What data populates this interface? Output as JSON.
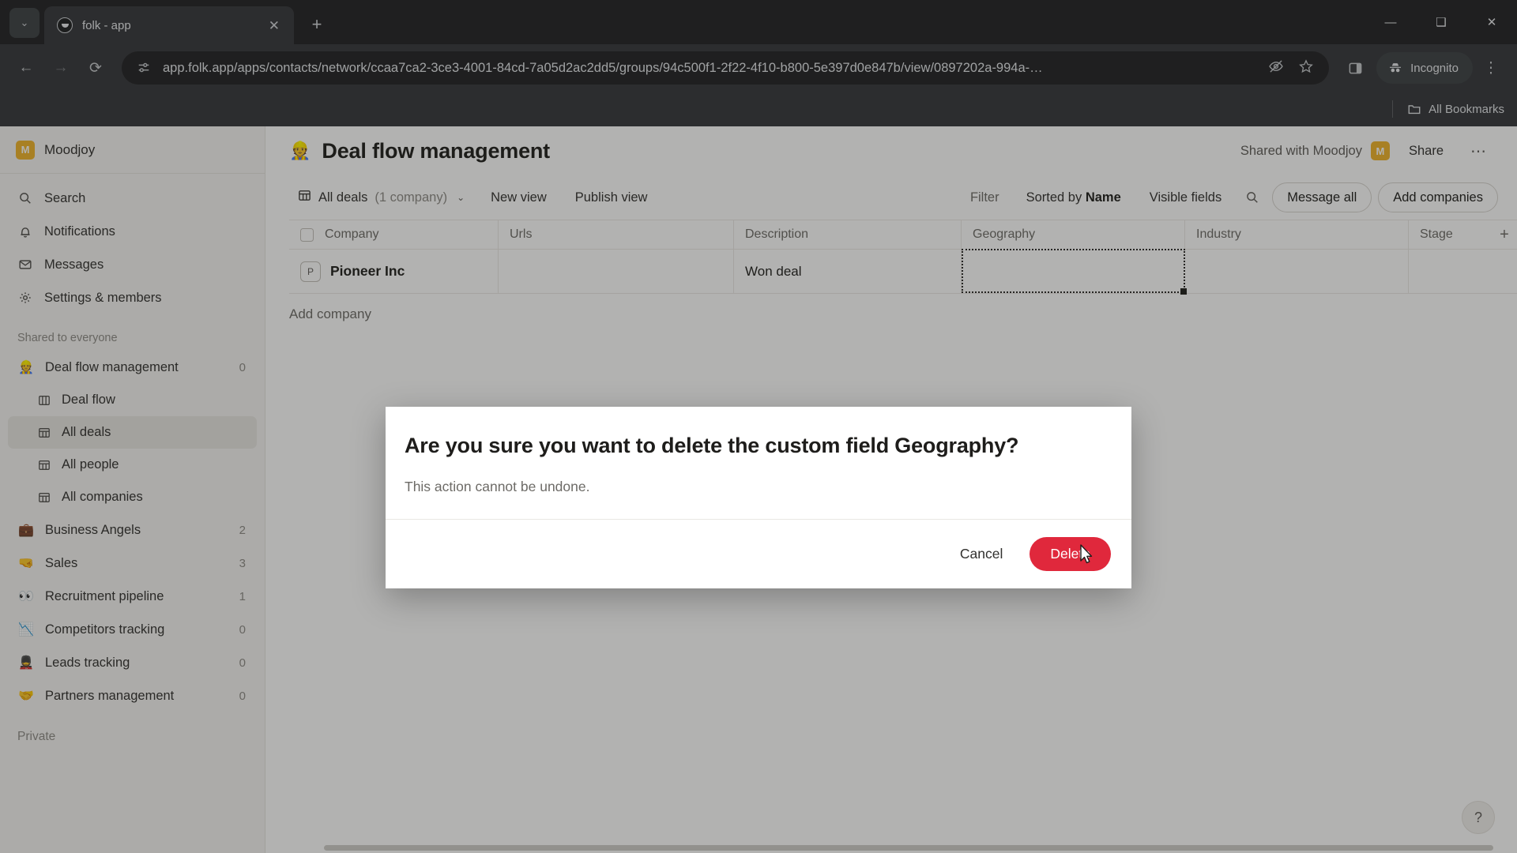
{
  "browser": {
    "tab": {
      "title": "folk - app",
      "favicon_name": "folk-favicon",
      "close_label": "✕"
    },
    "tab_list_chevron": "⌄",
    "new_tab_label": "+",
    "window_controls": {
      "minimize": "—",
      "maximize": "❑",
      "close": "✕"
    },
    "nav": {
      "back": "←",
      "forward": "→",
      "reload": "⟳"
    },
    "url": "app.folk.app/apps/contacts/network/ccaa7ca2-3ce3-4001-84cd-7a05d2ac2dd5/groups/94c500f1-2f22-4f10-b800-5e397d0e847b/view/0897202a-994a-…",
    "site_info_icon": "tune-icon",
    "hide_icon": "eye-off-icon",
    "bookmark_icon": "star-icon",
    "side_panel_icon": "side-panel-icon",
    "profile_label": "Incognito",
    "menu_icon": "⋮",
    "bookmarks_bar": {
      "all_bookmarks_label": "All Bookmarks",
      "folder_icon": "folder-icon"
    }
  },
  "sidebar": {
    "workspace": {
      "name": "Moodjoy",
      "initial": "M"
    },
    "nav_items": [
      {
        "label": "Search",
        "icon": "search-icon"
      },
      {
        "label": "Notifications",
        "icon": "bell-icon"
      },
      {
        "label": "Messages",
        "icon": "mail-icon"
      },
      {
        "label": "Settings & members",
        "icon": "gear-icon"
      }
    ],
    "shared_section_label": "Shared to everyone",
    "groups": [
      {
        "label": "Deal flow management",
        "count": "0",
        "emoji": "👷",
        "active": false
      },
      {
        "label": "Business Angels",
        "count": "2",
        "emoji": "💼"
      },
      {
        "label": "Sales",
        "count": "3",
        "emoji": "🤜"
      },
      {
        "label": "Recruitment pipeline",
        "count": "1",
        "emoji": "👀"
      },
      {
        "label": "Competitors tracking",
        "count": "0",
        "emoji": "📉"
      },
      {
        "label": "Leads tracking",
        "count": "0",
        "emoji": "💂"
      },
      {
        "label": "Partners management",
        "count": "0",
        "emoji": "🤝"
      }
    ],
    "subviews": [
      {
        "label": "Deal flow",
        "icon": "board-icon",
        "active": false
      },
      {
        "label": "All deals",
        "icon": "table-icon",
        "active": true
      },
      {
        "label": "All people",
        "icon": "table-icon",
        "active": false
      },
      {
        "label": "All companies",
        "icon": "table-icon",
        "active": false
      }
    ],
    "private_label": "Private"
  },
  "header": {
    "emoji": "👷",
    "title": "Deal flow management",
    "shared_with": "Shared with Moodjoy",
    "shared_avatar_initial": "M",
    "share_label": "Share",
    "more_label": "⋯"
  },
  "viewbar": {
    "view_icon": "table-icon",
    "view_name": "All deals",
    "view_count": "(1 company)",
    "chevron": "⌄",
    "new_view_label": "New view",
    "publish_view_label": "Publish view",
    "filter_label": "Filter",
    "sorted_by_prefix": "Sorted by ",
    "sorted_by_field": "Name",
    "visible_fields_label": "Visible fields",
    "search_icon": "search-icon",
    "message_all_label": "Message all",
    "add_companies_label": "Add companies"
  },
  "table": {
    "columns": [
      "Company",
      "Urls",
      "Description",
      "Geography",
      "Industry",
      "Stage"
    ],
    "add_column_label": "+",
    "rows": [
      {
        "badge": "P",
        "Company": "Pioneer Inc",
        "Urls": "",
        "Description": "Won deal",
        "Geography": "",
        "Industry": "",
        "Stage": ""
      }
    ],
    "selected_cell": "Geography",
    "add_company_label": "Add company"
  },
  "modal": {
    "title": "Are you sure you want to delete the custom field Geography?",
    "body": "This action cannot be undone.",
    "cancel_label": "Cancel",
    "delete_label": "Delete",
    "delete_color": "#e0283c"
  },
  "help_button": {
    "label": "?"
  }
}
